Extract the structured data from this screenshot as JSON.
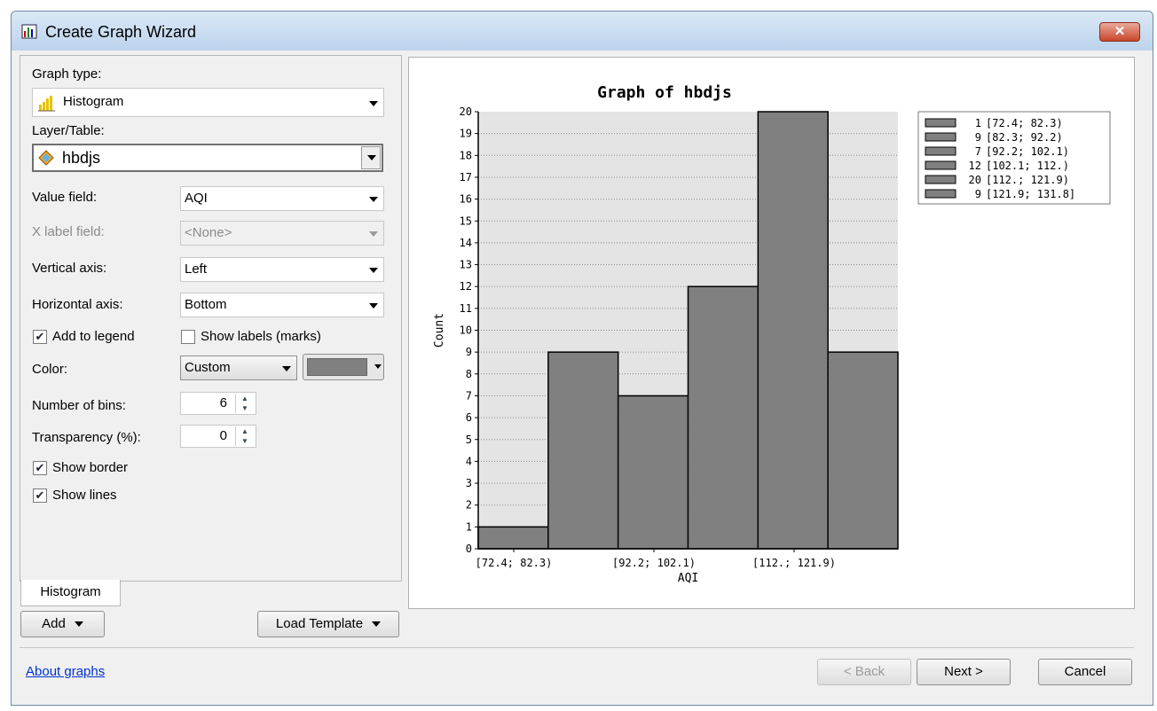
{
  "window": {
    "title": "Create Graph Wizard",
    "close_label": "✕"
  },
  "form": {
    "graph_type_label": "Graph type:",
    "graph_type": "Histogram",
    "layer_label": "Layer/Table:",
    "layer": "hbdjs",
    "value_field_label": "Value field:",
    "value_field": "AQI",
    "x_label_field_label": "X label field:",
    "x_label_field": "<None>",
    "vertical_axis_label": "Vertical axis:",
    "vertical_axis": "Left",
    "horizontal_axis_label": "Horizontal axis:",
    "horizontal_axis": "Bottom",
    "add_to_legend_label": "Add to legend",
    "add_to_legend": true,
    "show_labels_label": "Show labels (marks)",
    "show_labels": false,
    "color_label": "Color:",
    "color_mode": "Custom",
    "color": "#808080",
    "bins_label": "Number of bins:",
    "bins": "6",
    "transparency_label": "Transparency (%):",
    "transparency": "0",
    "show_border_label": "Show border",
    "show_border": true,
    "show_lines_label": "Show lines",
    "show_lines": true
  },
  "tabs": [
    "Histogram"
  ],
  "buttons": {
    "add": "Add",
    "load_template": "Load Template",
    "back": "< Back",
    "next": "Next >",
    "cancel": "Cancel"
  },
  "link": "About graphs",
  "chart_data": {
    "type": "bar",
    "title": "Graph of hbdjs",
    "xlabel": "AQI",
    "ylabel": "Count",
    "ylim": [
      0,
      20
    ],
    "categories": [
      "[72.4; 82.3)",
      "[82.3; 92.2)",
      "[92.2; 102.1)",
      "[102.1; 112.)",
      "[112.; 121.9)",
      "[121.9; 131.8]"
    ],
    "values": [
      1,
      9,
      7,
      12,
      20,
      9
    ],
    "xtick_labels": [
      "[72.4; 82.3)",
      "[92.2; 102.1)",
      "[112.; 121.9)"
    ],
    "legend": [
      "1 [72.4; 82.3)",
      "9 [82.3; 92.2)",
      "7 [92.2; 102.1)",
      "12 [102.1; 112.)",
      "20 [112.; 121.9)",
      "9 [121.9; 131.8]"
    ],
    "legend_position": "right",
    "grid": true,
    "bar_color": "#808080"
  }
}
